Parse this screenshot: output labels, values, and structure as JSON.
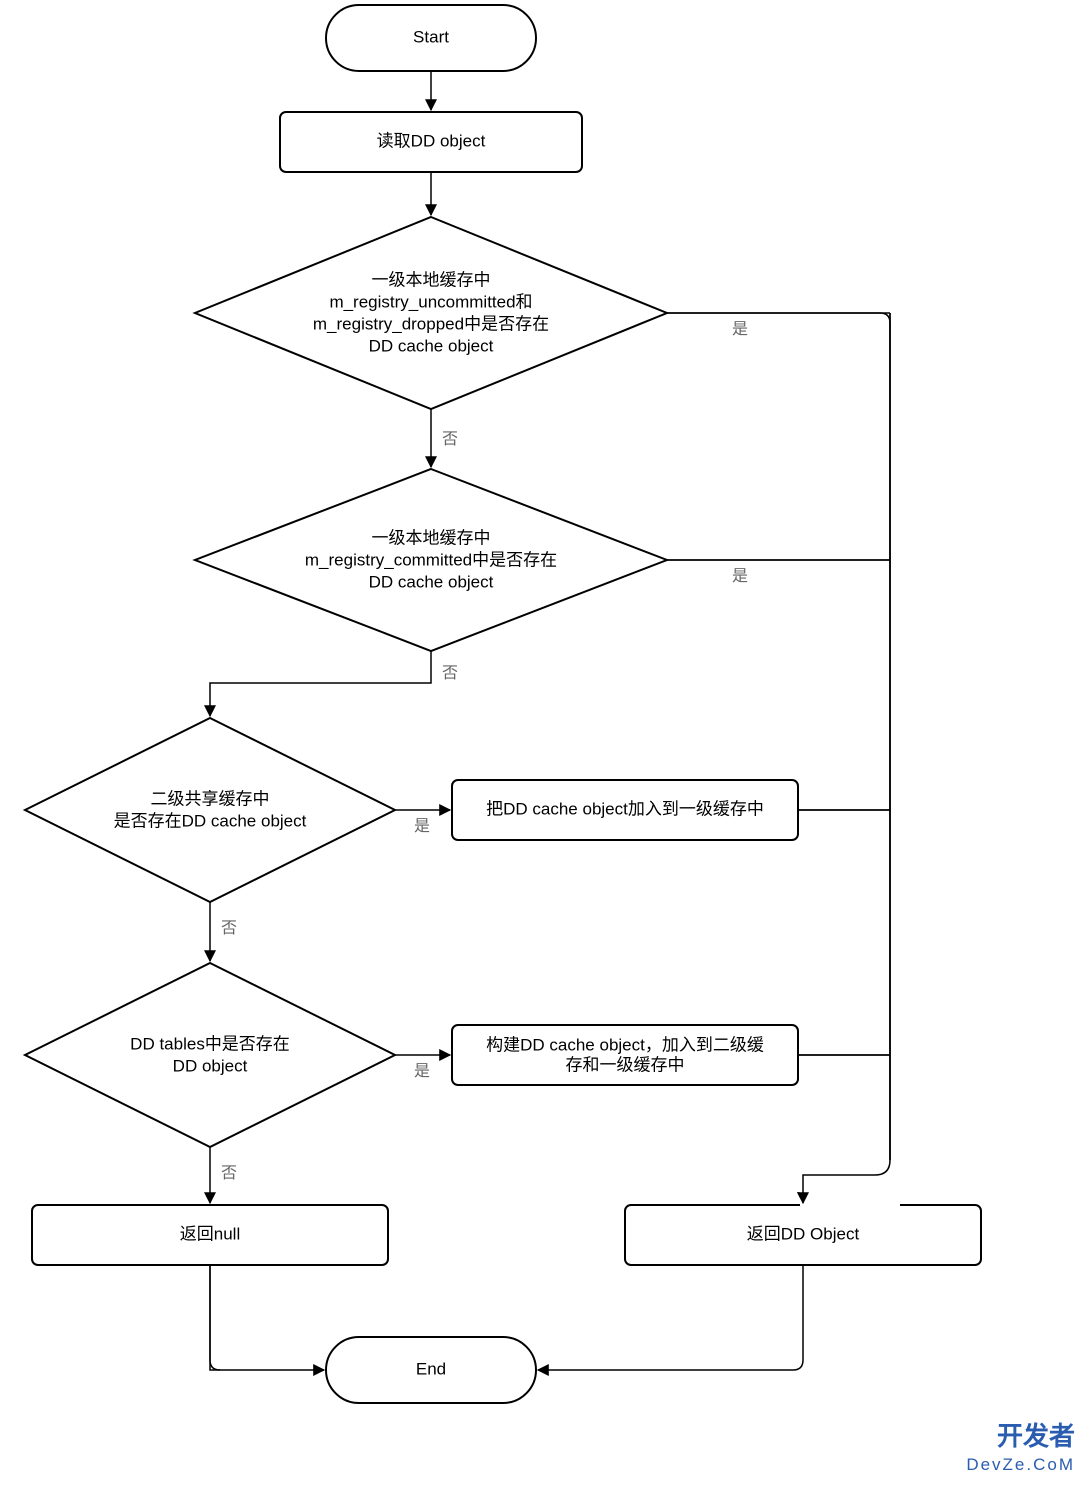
{
  "nodes": {
    "start": "Start",
    "read_dd": "读取DD object",
    "d1_l1": "一级本地缓存中",
    "d1_l2": "m_registry_uncommitted和",
    "d1_l3": "m_registry_dropped中是否存在",
    "d1_l4": "DD cache object",
    "d2_l1": "一级本地缓存中",
    "d2_l2": "m_registry_committed中是否存在",
    "d2_l3": "DD cache object",
    "d3_l1": "二级共享缓存中",
    "d3_l2": "是否存在DD cache object",
    "d4_l1": "DD tables中是否存在",
    "d4_l2": "DD object",
    "p1": "把DD cache object加入到一级缓存中",
    "p2_l1": "构建DD cache object，加入到二级缓",
    "p2_l2": "存和一级缓存中",
    "ret_null": "返回null",
    "ret_obj": "返回DD Object",
    "end": "End"
  },
  "labels": {
    "yes": "是",
    "no": "否"
  },
  "watermark": {
    "title": "开发者",
    "sub": "DevZe.CoM"
  }
}
